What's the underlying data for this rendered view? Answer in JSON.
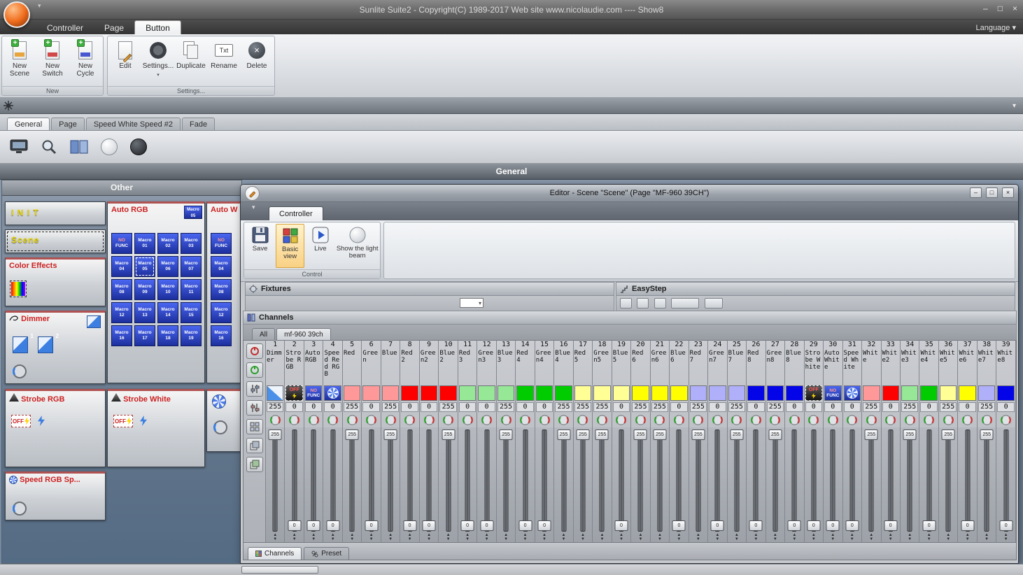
{
  "titlebar": {
    "title": "Sunlite Suite2 - Copyright(C) 1989-2017    Web site www.nicolaudie.com ---- Show8"
  },
  "menu": {
    "tabs": [
      "Controller",
      "Page",
      "Button"
    ],
    "active_tab": "Button",
    "language": "Language"
  },
  "ribbon": {
    "new_group": {
      "label": "New",
      "buttons": [
        "New Scene",
        "New Switch",
        "New Cycle"
      ]
    },
    "settings_group": {
      "label": "Settings...",
      "buttons": [
        "Edit",
        "Settings...",
        "Duplicate",
        "Rename",
        "Delete"
      ],
      "rename_icon_text": "Txt"
    }
  },
  "page_tabs": {
    "tabs": [
      "General",
      "Page",
      "Speed White Speed #2",
      "Fade"
    ],
    "active": "General"
  },
  "general_header": "General",
  "other_panel": {
    "header": "Other",
    "init_label": "I N I T",
    "scene_label": "Scene",
    "color_effects_label": "Color Effects",
    "dimmer_label": "Dimmer",
    "dimmer_fader_1": "1",
    "dimmer_fader_2": "2",
    "strobe_rgb_label": "Strobe RGB",
    "strobe_white_label": "Strobe White",
    "speed_rgb_label": "Speed RGB Sp...",
    "off_label": "OFF",
    "auto_rgb": {
      "title": "Auto RGB",
      "badge": "Macro 05",
      "selected": "Macro 05",
      "macros": [
        "NO FUNC",
        "Macro 01",
        "Macro 02",
        "Macro 03",
        "Macro 04",
        "Macro 05",
        "Macro 06",
        "Macro 07",
        "Macro 08",
        "Macro 09",
        "Macro 10",
        "Macro 11",
        "Macro 12",
        "Macro 13",
        "Macro 14",
        "Macro 15",
        "Macro 16",
        "Macro 17",
        "Macro 18",
        "Macro 19"
      ]
    },
    "auto_white": {
      "title": "Auto W",
      "selected": "",
      "macros": [
        "NO FUNC",
        "Macro 04",
        "Macro 08",
        "Macro 12",
        "Macro 16"
      ]
    }
  },
  "editor": {
    "title": "Editor - Scene \"Scene\" (Page \"MF-960 39CH\")",
    "tab": "Controller",
    "control_group_label": "Control",
    "buttons": {
      "save": "Save",
      "basic_view": "Basic view",
      "live": "Live",
      "show_beam": "Show the light beam"
    },
    "fixtures_header": "Fixtures",
    "easystep_header": "EasyStep",
    "channels_header": "Channels",
    "channel_tabs": [
      "All",
      "mf-960 39ch"
    ],
    "active_channel_tab": "mf-960 39ch",
    "bottom_tabs": [
      "Channels",
      "Preset"
    ],
    "active_bottom_tab": "Channels",
    "swatch_labels": {
      "off": "OFF",
      "nofunc_no": "NO",
      "nofunc_func": "FUNC"
    },
    "channels": [
      {
        "num": 1,
        "name": "Dimmer",
        "swatch": "dimmer",
        "value": 255
      },
      {
        "num": 2,
        "name": "Strobe RGB",
        "swatch": "off",
        "value": 0
      },
      {
        "num": 3,
        "name": "Auto RGB",
        "swatch": "nofunc",
        "value": 0
      },
      {
        "num": 4,
        "name": "Speed Red RGB",
        "swatch": "speed",
        "value": 0
      },
      {
        "num": 5,
        "name": "Red",
        "swatch": "#ff9898",
        "value": 255
      },
      {
        "num": 6,
        "name": "Green",
        "swatch": "#ff9898",
        "value": 0
      },
      {
        "num": 7,
        "name": "Blue",
        "swatch": "#ff9898",
        "value": 255
      },
      {
        "num": 8,
        "name": "Red 2",
        "swatch": "#ff0000",
        "value": 0
      },
      {
        "num": 9,
        "name": "Green2",
        "swatch": "#ff0000",
        "value": 0
      },
      {
        "num": 10,
        "name": "Blue2",
        "swatch": "#ff0000",
        "value": 255
      },
      {
        "num": 11,
        "name": "Red 3",
        "swatch": "#96e896",
        "value": 0
      },
      {
        "num": 12,
        "name": "Green3",
        "swatch": "#96e896",
        "value": 0
      },
      {
        "num": 13,
        "name": "Blue3",
        "swatch": "#96e896",
        "value": 255
      },
      {
        "num": 14,
        "name": "Red 4",
        "swatch": "#00cc00",
        "value": 0
      },
      {
        "num": 15,
        "name": "Green4",
        "swatch": "#00cc00",
        "value": 0
      },
      {
        "num": 16,
        "name": "Blue4",
        "swatch": "#00cc00",
        "value": 255
      },
      {
        "num": 17,
        "name": "Red 5",
        "swatch": "#ffff96",
        "value": 255
      },
      {
        "num": 18,
        "name": "Green5",
        "swatch": "#ffff96",
        "value": 255
      },
      {
        "num": 19,
        "name": "Blue5",
        "swatch": "#ffff96",
        "value": 0
      },
      {
        "num": 20,
        "name": "Red 6",
        "swatch": "#ffff00",
        "value": 255
      },
      {
        "num": 21,
        "name": "Green6",
        "swatch": "#ffff00",
        "value": 255
      },
      {
        "num": 22,
        "name": "Blue6",
        "swatch": "#ffff00",
        "value": 0
      },
      {
        "num": 23,
        "name": "Red 7",
        "swatch": "#b0b0fa",
        "value": 255
      },
      {
        "num": 24,
        "name": "Green7",
        "swatch": "#b0b0fa",
        "value": 0
      },
      {
        "num": 25,
        "name": "Blue7",
        "swatch": "#b0b0fa",
        "value": 255
      },
      {
        "num": 26,
        "name": "Red 8",
        "swatch": "#0404e8",
        "value": 0
      },
      {
        "num": 27,
        "name": "Green8",
        "swatch": "#0404e8",
        "value": 255
      },
      {
        "num": 28,
        "name": "Blue8",
        "swatch": "#0404e8",
        "value": 0
      },
      {
        "num": 29,
        "name": "Strobe White",
        "swatch": "off",
        "value": 0
      },
      {
        "num": 30,
        "name": "Auto White",
        "swatch": "nofunc",
        "value": 0
      },
      {
        "num": 31,
        "name": "Speed White",
        "swatch": "speed",
        "value": 0
      },
      {
        "num": 32,
        "name": "White",
        "swatch": "#ff9898",
        "value": 255
      },
      {
        "num": 33,
        "name": "White2",
        "swatch": "#ff0000",
        "value": 0
      },
      {
        "num": 34,
        "name": "White3",
        "swatch": "#96e896",
        "value": 255
      },
      {
        "num": 35,
        "name": "White4",
        "swatch": "#00cc00",
        "value": 0
      },
      {
        "num": 36,
        "name": "White5",
        "swatch": "#ffff96",
        "value": 255
      },
      {
        "num": 37,
        "name": "White6",
        "swatch": "#ffff00",
        "value": 0
      },
      {
        "num": 38,
        "name": "White7",
        "swatch": "#b0b0fa",
        "value": 255
      },
      {
        "num": 39,
        "name": "White8",
        "swatch": "#0404e8",
        "value": 0
      }
    ]
  }
}
